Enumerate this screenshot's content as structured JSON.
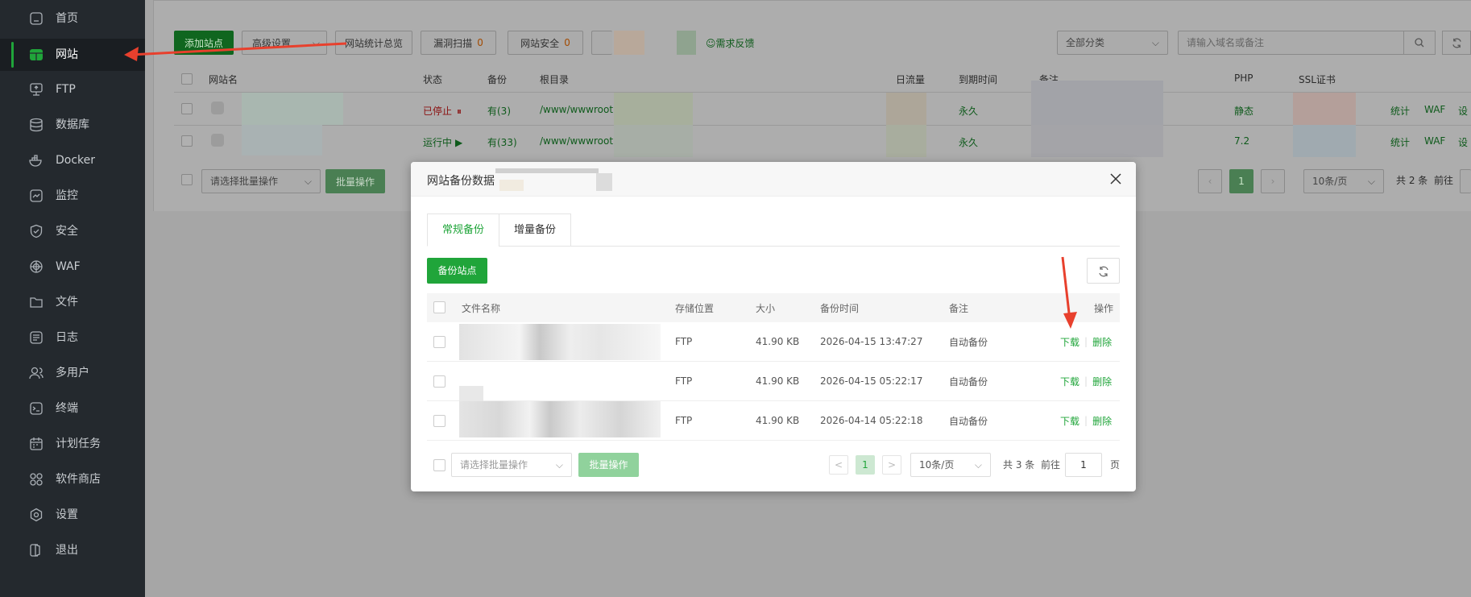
{
  "sidebar": {
    "items": [
      {
        "label": "首页",
        "icon": "home-icon"
      },
      {
        "label": "网站",
        "icon": "website-icon",
        "active": true
      },
      {
        "label": "FTP",
        "icon": "ftp-icon"
      },
      {
        "label": "数据库",
        "icon": "database-icon"
      },
      {
        "label": "Docker",
        "icon": "docker-icon"
      },
      {
        "label": "监控",
        "icon": "monitor-icon"
      },
      {
        "label": "安全",
        "icon": "shield-icon"
      },
      {
        "label": "WAF",
        "icon": "waf-icon"
      },
      {
        "label": "文件",
        "icon": "folder-icon"
      },
      {
        "label": "日志",
        "icon": "log-icon"
      },
      {
        "label": "多用户",
        "icon": "users-icon"
      },
      {
        "label": "终端",
        "icon": "terminal-icon"
      },
      {
        "label": "计划任务",
        "icon": "calendar-icon"
      },
      {
        "label": "软件商店",
        "icon": "apps-icon"
      },
      {
        "label": "设置",
        "icon": "gear-icon"
      },
      {
        "label": "退出",
        "icon": "logout-icon"
      }
    ]
  },
  "background": {
    "toolbar": {
      "add_site": "添加站点",
      "advanced": "高级设置",
      "stats": "网站统计总览",
      "scan": "漏洞扫描",
      "scan_count": "0",
      "security": "网站安全",
      "security_count": "0",
      "feedback": "需求反馈",
      "category": "全部分类",
      "search_placeholder": "请输入域名或备注"
    },
    "table_headers": {
      "name": "网站名",
      "status": "状态",
      "backup": "备份",
      "root": "根目录",
      "traffic": "日流量",
      "expire": "到期时间",
      "remark": "备注",
      "php": "PHP",
      "ssl": "SSL证书"
    },
    "rows": [
      {
        "status": "已停止",
        "backup": "有(3)",
        "root": "/www/wwwroot,",
        "expire": "永久",
        "php": "静态",
        "actions": [
          "统计",
          "WAF",
          "设"
        ]
      },
      {
        "status": "运行中",
        "backup": "有(33)",
        "root": "/www/wwwroot,",
        "expire": "永久",
        "php": "7.2",
        "actions": [
          "统计",
          "WAF",
          "设"
        ]
      }
    ],
    "footer": {
      "batch_placeholder": "请选择批量操作",
      "batch_btn": "批量操作",
      "page": "1",
      "per_page": "10条/页",
      "total": "共 2 条",
      "goto": "前往"
    }
  },
  "modal": {
    "title": "网站备份数据",
    "tabs": [
      "常规备份",
      "增量备份"
    ],
    "backup_btn": "备份站点",
    "columns": {
      "filename": "文件名称",
      "storage": "存储位置",
      "size": "大小",
      "time": "备份时间",
      "remark": "备注",
      "actions": "操作"
    },
    "rows": [
      {
        "storage": "FTP",
        "size": "41.90 KB",
        "time": "2026-04-15 13:47:27",
        "remark": "自动备份",
        "download": "下载",
        "delete": "删除"
      },
      {
        "storage": "FTP",
        "size": "41.90 KB",
        "time": "2026-04-15 05:22:17",
        "remark": "自动备份",
        "download": "下载",
        "delete": "删除"
      },
      {
        "storage": "FTP",
        "size": "41.90 KB",
        "time": "2026-04-14 05:22:18",
        "remark": "自动备份",
        "download": "下载",
        "delete": "删除"
      }
    ],
    "footer": {
      "batch_placeholder": "请选择批量操作",
      "batch_btn": "批量操作",
      "prev": "<",
      "page": "1",
      "next": ">",
      "per_page": "10条/页",
      "total": "共 3 条",
      "goto": "前往",
      "goto_value": "1",
      "page_unit": "页"
    }
  },
  "colors": {
    "accent": "#20a53a",
    "sidebar_bg": "#24292e",
    "annotation_arrow": "#e8402d"
  }
}
